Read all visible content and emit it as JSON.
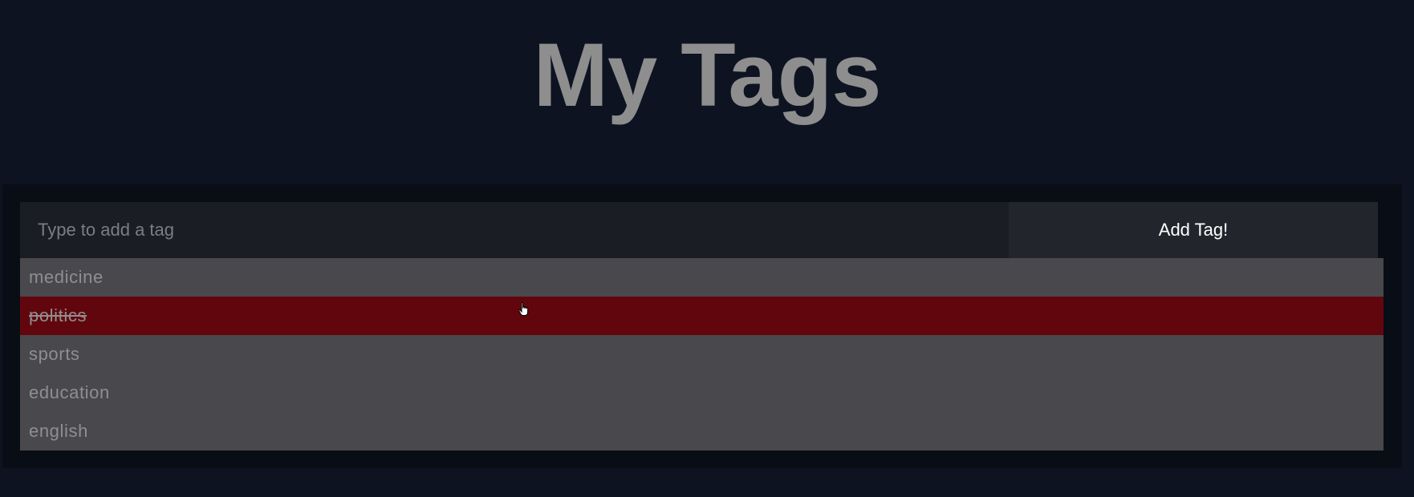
{
  "page": {
    "title": "My Tags"
  },
  "form": {
    "input_placeholder": "Type to add a tag",
    "input_value": "",
    "add_button_label": "Add Tag!"
  },
  "tags": [
    {
      "label": "medicine",
      "state": "normal"
    },
    {
      "label": "politics",
      "state": "hovered-strikethrough"
    },
    {
      "label": "sports",
      "state": "normal"
    },
    {
      "label": "education",
      "state": "normal"
    },
    {
      "label": "english",
      "state": "normal"
    }
  ],
  "colors": {
    "page_background": "#0d1321",
    "panel_background": "#090d15",
    "input_background": "#1a1d24",
    "button_background": "#22262c",
    "tag_background": "#49484d",
    "tag_hover_background": "#62060d",
    "title_color": "#8e8e8e"
  },
  "cursor": {
    "icon": "hand-pointer-icon"
  }
}
